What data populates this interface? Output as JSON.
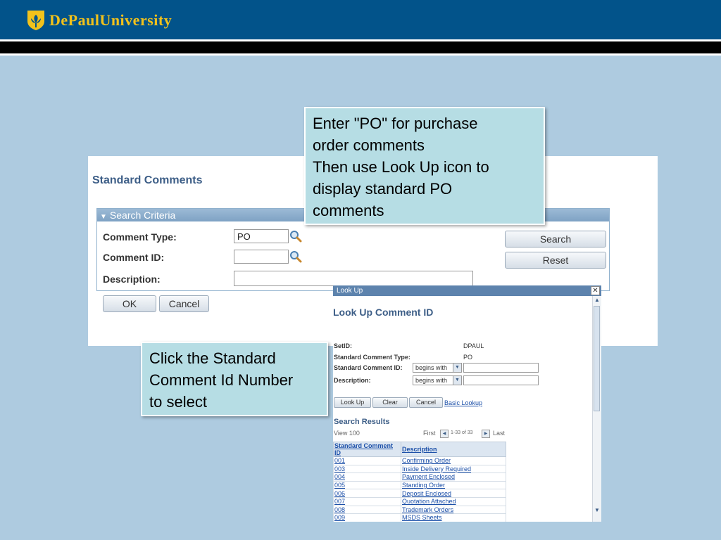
{
  "header": {
    "university": "DePaulUniversity"
  },
  "standard_comments": {
    "title": "Standard Comments",
    "section_title": "Search Criteria",
    "comment_type_label": "Comment Type:",
    "comment_type_value": "PO",
    "comment_id_label": "Comment ID:",
    "comment_id_value": "",
    "description_label": "Description:",
    "description_value": "",
    "search_button": "Search",
    "reset_button": "Reset",
    "ok_button": "OK",
    "cancel_button": "Cancel"
  },
  "callouts": {
    "top": [
      "Enter \"PO\" for purchase",
      "order comments",
      "Then use Look Up icon to",
      "display standard PO",
      "comments"
    ],
    "bottom": [
      "Click the Standard",
      "Comment Id Number",
      "to select"
    ]
  },
  "lookup": {
    "window_title": "Look Up",
    "title": "Look Up Comment ID",
    "setid_label": "SetID:",
    "setid_value": "DPAUL",
    "type_label": "Standard Comment Type:",
    "type_value": "PO",
    "id_label": "Standard Comment ID:",
    "id_operator": "begins with",
    "desc_label": "Description:",
    "desc_operator": "begins with",
    "lookup_button": "Look Up",
    "clear_button": "Clear",
    "cancel_button": "Cancel",
    "basic_lookup_link": "Basic Lookup",
    "results_title": "Search Results",
    "view_all": "View 100",
    "first": "First",
    "range": "1-33 of 33",
    "last": "Last",
    "columns": [
      "Standard Comment ID",
      "Description"
    ],
    "rows": [
      [
        "001",
        "Confirming Order"
      ],
      [
        "003",
        "Inside Delivery Required"
      ],
      [
        "004",
        "Payment Enclosed"
      ],
      [
        "005",
        "Standing Order"
      ],
      [
        "006",
        "Deposit Enclosed"
      ],
      [
        "007",
        "Quotation Attached"
      ],
      [
        "008",
        "Trademark Orders"
      ],
      [
        "009",
        "MSDS Sheets"
      ]
    ]
  },
  "colors": {
    "header_bg": "#02538a",
    "background": "#aecbe0",
    "logo_gold": "#f2c21b",
    "callout_bg": "#b6dde4",
    "ps_title": "#3d5e87"
  }
}
